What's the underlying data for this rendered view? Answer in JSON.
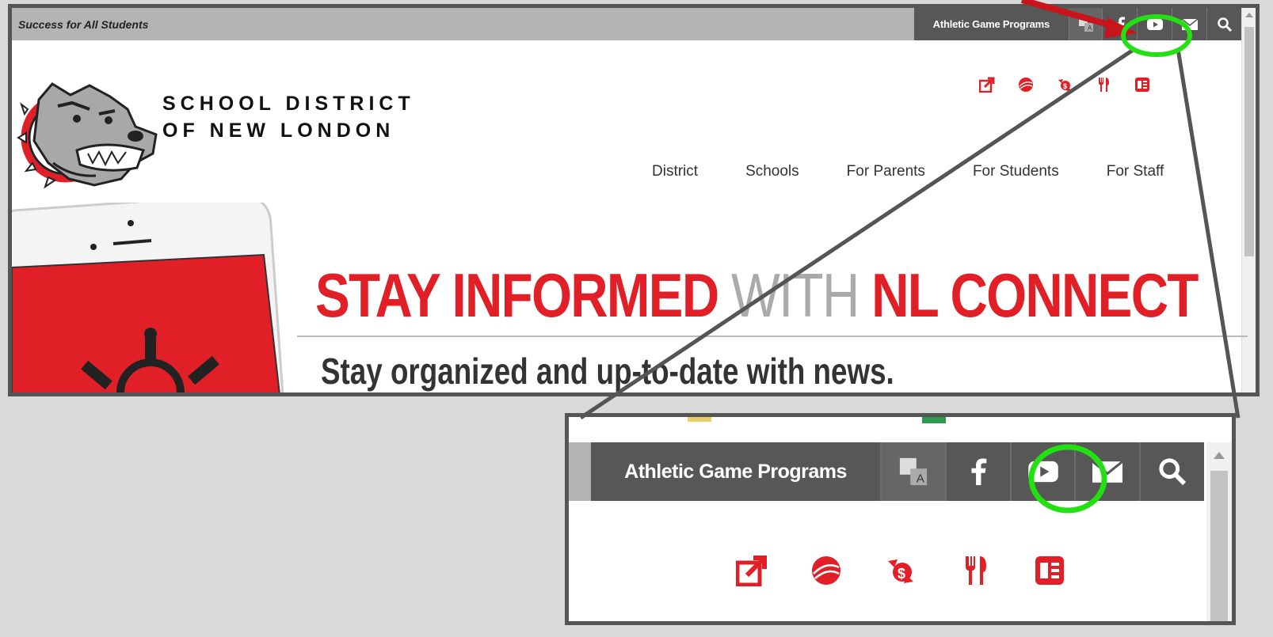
{
  "topbar": {
    "tagline": "Success for All Students",
    "athletic_label": "Athletic Game Programs",
    "icons": [
      "translate-icon",
      "facebook-icon",
      "youtube-icon",
      "mail-icon",
      "search-icon"
    ]
  },
  "header": {
    "district_line1": "SCHOOL DISTRICT",
    "district_line2": "OF NEW LONDON",
    "quick_links": [
      "external-link-icon",
      "sports-ball-icon",
      "payment-icon",
      "food-menu-icon",
      "calendar-icon"
    ]
  },
  "nav": {
    "items": [
      "District",
      "Schools",
      "For Parents",
      "For Students",
      "For Staff"
    ]
  },
  "hero": {
    "title_part1": "STAY INFORMED ",
    "title_with": "WITH",
    "title_part2": " NL CONNECT",
    "subtitle": "Stay organized and up-to-date with news."
  },
  "zoom": {
    "athletic_label": "Athletic Game Programs"
  },
  "colors": {
    "brand_red": "#e11f26",
    "bar_dark": "#575757",
    "bar_light": "#b4b4b4",
    "highlight_green": "#22e011",
    "arrow_red": "#c8151b"
  }
}
